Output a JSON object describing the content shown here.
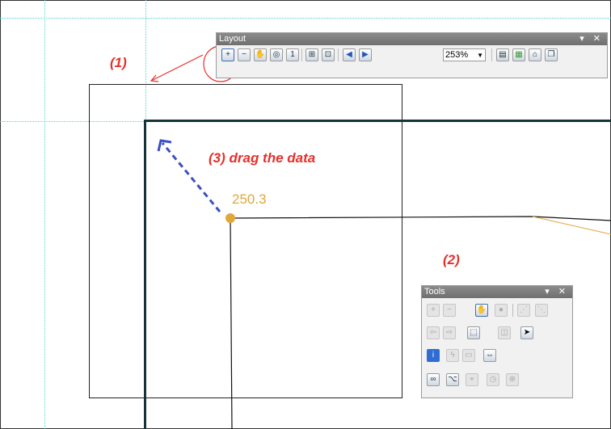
{
  "layout_toolbar": {
    "title": "Layout",
    "zoom_value": "253%",
    "title_controls": "▾ ✕"
  },
  "tools_toolbar": {
    "title": "Tools",
    "title_controls": "▾ ✕"
  },
  "annotations": {
    "step1": "(1)",
    "step2": "(2)",
    "step3": "(3) drag the data",
    "point_value": "250.3"
  },
  "colors": {
    "annotation_red": "#e5302b",
    "guide_cyan": "#46d6d6",
    "point_orange": "#e0a73c",
    "drag_arrow_blue": "#3b4fc4"
  },
  "icons": {
    "layout": [
      "zoom-in-icon",
      "zoom-out-icon",
      "pan-icon",
      "zoom-whole-page-icon",
      "zoom-100-icon",
      "fixed-zoom-in-icon",
      "fixed-zoom-out-icon",
      "previous-extent-icon",
      "next-extent-icon",
      "toggle-draft-mode-icon",
      "focus-data-frame-icon",
      "change-layout-icon",
      "data-driven-pages-icon"
    ],
    "tools": [
      "zoom-in-icon",
      "zoom-out-icon",
      "pan-icon",
      "full-extent-icon",
      "fixed-zoom-in-icon",
      "fixed-zoom-out-icon",
      "back-icon",
      "forward-icon",
      "select-features-icon",
      "clear-selection-icon",
      "select-elements-icon",
      "identify-icon",
      "hyperlink-icon",
      "html-popup-icon",
      "measure-icon",
      "find-icon",
      "find-route-icon",
      "go-to-xy-icon",
      "time-slider-icon",
      "create-viewer-window-icon"
    ]
  }
}
